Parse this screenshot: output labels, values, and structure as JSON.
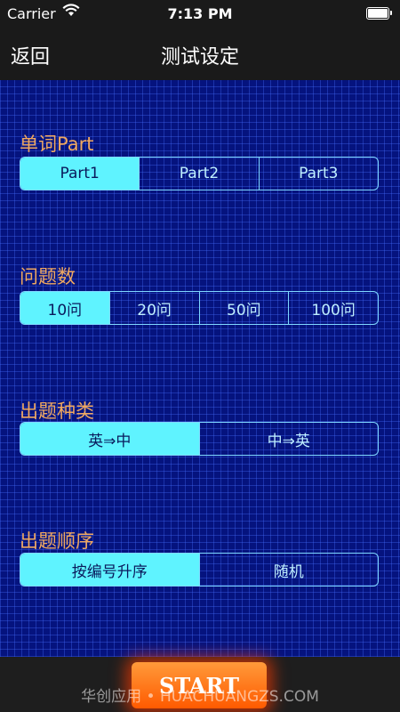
{
  "status_bar": {
    "carrier": "Carrier",
    "time": "7:13 PM"
  },
  "nav": {
    "back_label": "返回",
    "title": "测试设定"
  },
  "sections": [
    {
      "label": "单词Part",
      "options": [
        "Part1",
        "Part2",
        "Part3"
      ],
      "selected": 0
    },
    {
      "label": "问题数",
      "options": [
        "10问",
        "20问",
        "50问",
        "100问"
      ],
      "selected": 0
    },
    {
      "label": "出题种类",
      "options": [
        "英⇒中",
        "中⇒英"
      ],
      "selected": 0
    },
    {
      "label": "出题顺序",
      "options": [
        "按编号升序",
        "随机"
      ],
      "selected": 0
    }
  ],
  "start_label": "START",
  "watermark": "华创应用 • HUACHUANGZS.COM",
  "colors": {
    "accent": "#5ff3ff",
    "background": "#05137e",
    "label": "#f0a860",
    "start": "#ff5a00"
  }
}
